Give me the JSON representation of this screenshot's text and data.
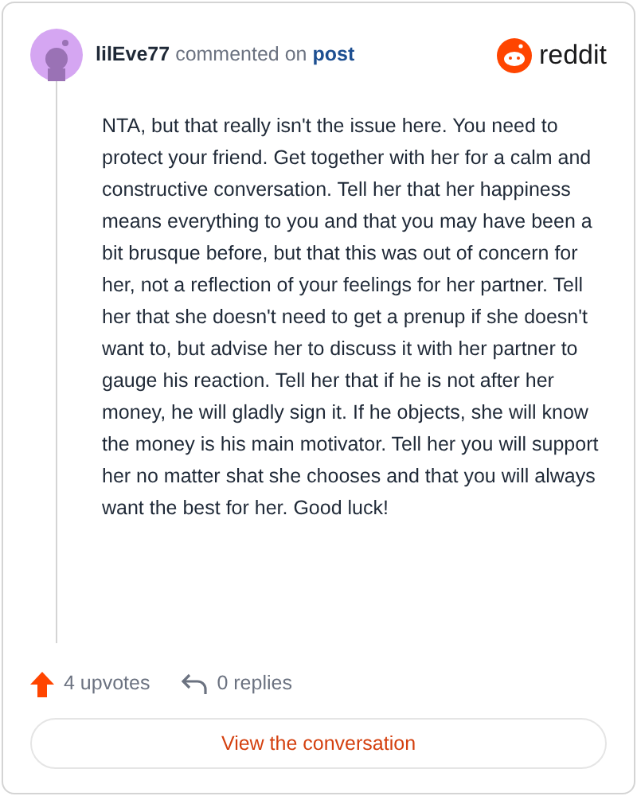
{
  "comment": {
    "author": "lilEve77",
    "action": "commented on",
    "link": "post",
    "brand": "reddit",
    "body": "NTA, but that really isn't the issue here. You need to protect your friend. Get together with her for a calm and constructive conversation. Tell her that her happiness means everything to you and that you may have been a bit brusque before, but that this was out of concern for her, not a reflection of your feelings for her partner. Tell her that she doesn't need to get a prenup if she doesn't want to, but advise her to discuss it with her partner to gauge his reaction. Tell her that if he is not after her money, he will gladly sign it. If he objects, she will know the money is his main motivator. Tell her you will support her no matter shat she chooses and that you will always want the best for her. Good luck!",
    "upvotes": "4 upvotes",
    "replies": "0 replies",
    "button": "View the conversation"
  }
}
